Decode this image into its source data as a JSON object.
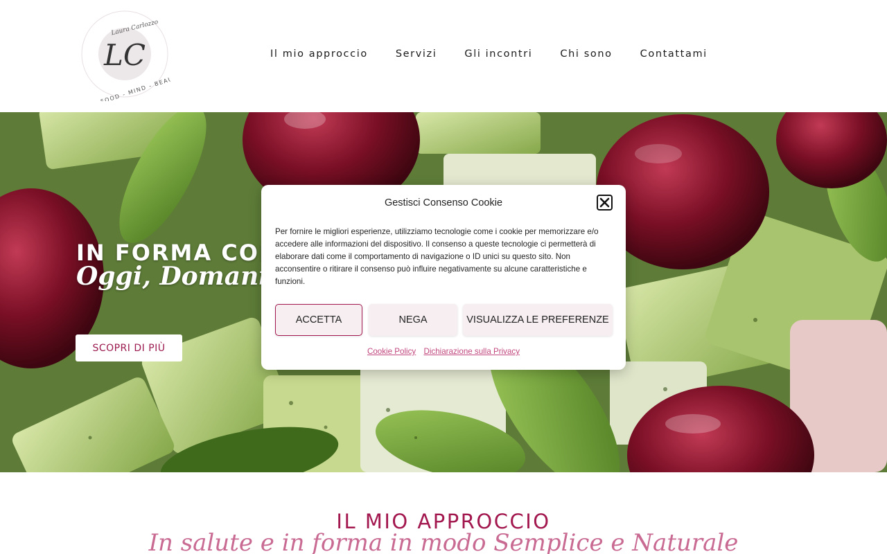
{
  "brand": {
    "logo_initials": "LC",
    "logo_signature": "Laura Carlozzo",
    "logo_tagline": "FOOD - MIND - BEAUTY"
  },
  "nav": {
    "items": [
      {
        "label": "Il mio approccio"
      },
      {
        "label": "Servizi"
      },
      {
        "label": "Gli incontri"
      },
      {
        "label": "Chi sono"
      },
      {
        "label": "Contattami"
      }
    ]
  },
  "hero": {
    "title": "IN FORMA CON",
    "subtitle": "Oggi, Domani,",
    "cta_label": "SCOPRI DI PIÙ"
  },
  "cookie_modal": {
    "title": "Gestisci Consenso Cookie",
    "body": "Per fornire le migliori esperienze, utilizziamo tecnologie come i cookie per memorizzare e/o accedere alle informazioni del dispositivo. Il consenso a queste tecnologie ci permetterà di elaborare dati come il comportamento di navigazione o ID unici su questo sito. Non acconsentire o ritirare il consenso può influire negativamente su alcune caratteristiche e funzioni.",
    "accept_label": "ACCETTA",
    "deny_label": "NEGA",
    "preferences_label": "VISUALIZZA LE PREFERENZE",
    "cookie_policy_label": "Cookie Policy",
    "privacy_label": "Dichiarazione sulla Privacy",
    "close_icon": "close-icon"
  },
  "approach": {
    "title": "IL MIO APPROCCIO",
    "subtitle": "In salute e in forma in modo Semplice e Naturale"
  },
  "colors": {
    "accent": "#a3174f",
    "accent_light": "#c96a93",
    "button_bg": "#f6eef0"
  }
}
